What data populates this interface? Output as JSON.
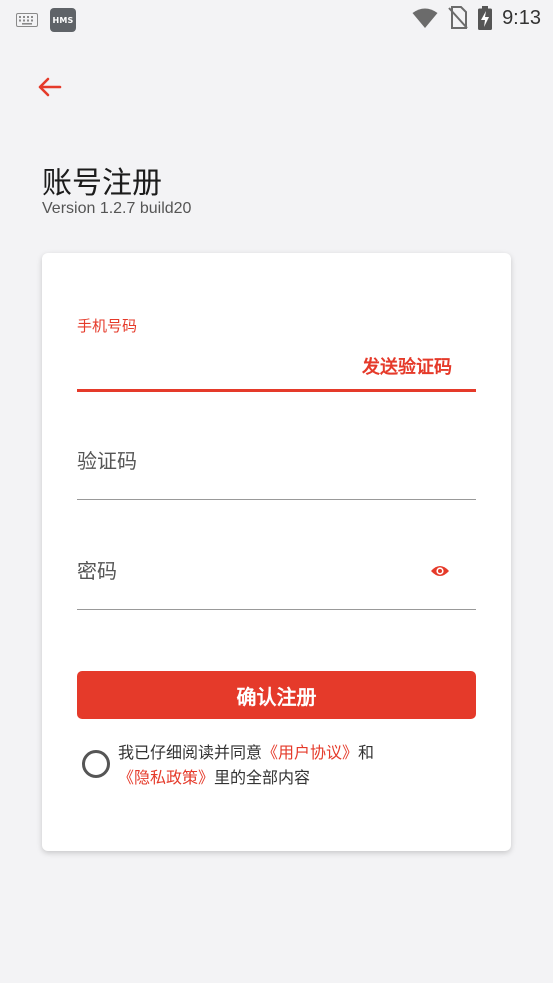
{
  "status_bar": {
    "hms_label": "HMS",
    "time": "9:13",
    "icons": [
      "keyboard-icon",
      "hms-icon",
      "wifi-icon",
      "no-sim-icon",
      "battery-charging-icon"
    ]
  },
  "header": {
    "back_icon": "arrow-left-icon",
    "title": "账号注册",
    "version": "Version 1.2.7 build20"
  },
  "form": {
    "phone": {
      "label": "手机号码",
      "value": ""
    },
    "send_code_label": "发送验证码",
    "code": {
      "placeholder": "验证码",
      "value": ""
    },
    "password": {
      "placeholder": "密码",
      "value": "",
      "toggle_icon": "eye-icon"
    },
    "submit_label": "确认注册"
  },
  "agreement": {
    "prefix": "我已仔细阅读并同意",
    "user_agreement": "《用户协议》",
    "and": "和",
    "privacy_policy": "《隐私政策》",
    "suffix": "里的全部内容",
    "checked": false
  },
  "colors": {
    "accent": "#e53a2a",
    "background": "#f3f3f5",
    "card": "#ffffff"
  }
}
